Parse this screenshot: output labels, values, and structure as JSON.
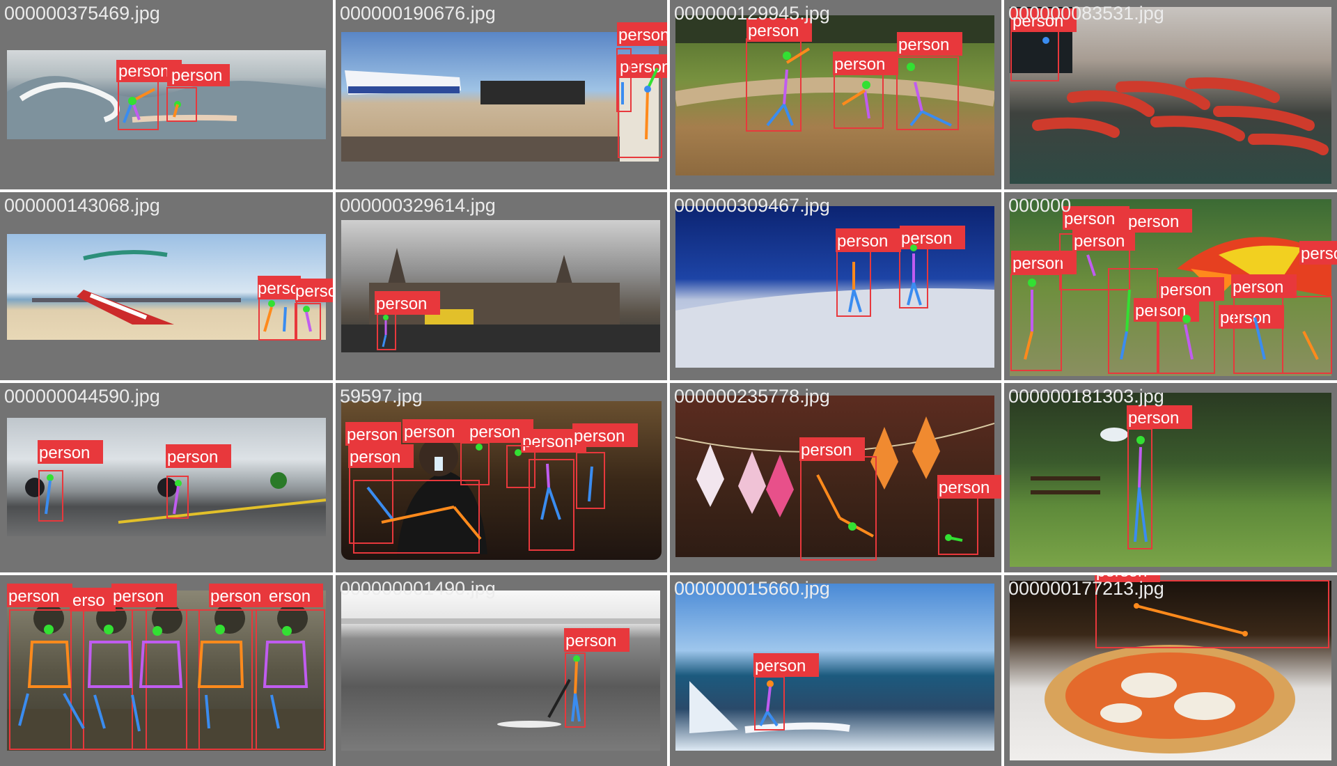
{
  "grid_title": "",
  "box_color": "#e8383c",
  "label_text_color": "#ffffff",
  "tile_background": "#737373",
  "skeleton_colors": {
    "head": "#33e033",
    "arms": "#ff8a1c",
    "torso": "#c05cf0",
    "legs": "#3a8cf0"
  },
  "tiles": [
    {
      "filename": "000000375469.jpg",
      "scene": "surf-wave",
      "detections": [
        {
          "label": "person"
        },
        {
          "label": "person"
        }
      ]
    },
    {
      "filename": "000000190676.jpg",
      "scene": "airfield-plane",
      "detections": [
        {
          "label": "person"
        },
        {
          "label": "person"
        }
      ]
    },
    {
      "filename": "000000129945.jpg",
      "scene": "baseball-field",
      "detections": [
        {
          "label": "person"
        },
        {
          "label": "person"
        },
        {
          "label": "person"
        }
      ]
    },
    {
      "filename": "000000083531.jpg",
      "scene": "sausage-grill",
      "detections": [
        {
          "label": "person"
        }
      ]
    },
    {
      "filename": "000000143068.jpg",
      "scene": "kite-beach",
      "detections": [
        {
          "label": "person"
        },
        {
          "label": "person"
        }
      ]
    },
    {
      "filename": "000000329614.jpg",
      "scene": "cathedral-street",
      "detections": [
        {
          "label": "person"
        }
      ]
    },
    {
      "filename": "000000309467.jpg",
      "scene": "ski-slope",
      "detections": [
        {
          "label": "person"
        },
        {
          "label": "person"
        }
      ]
    },
    {
      "filename": "000000",
      "scene": "picnic-umbrella",
      "detections": [
        {
          "label": "person"
        },
        {
          "label": "person"
        },
        {
          "label": "person"
        },
        {
          "label": "person"
        },
        {
          "label": "person"
        },
        {
          "label": "person"
        },
        {
          "label": "person"
        },
        {
          "label": "person"
        },
        {
          "label": "person"
        }
      ]
    },
    {
      "filename": "000000044590.jpg",
      "scene": "motorcycle-road",
      "detections": [
        {
          "label": "person"
        },
        {
          "label": "person"
        }
      ]
    },
    {
      "filename": "59597.jpg",
      "scene": "restaurant-phone",
      "detections": [
        {
          "label": "person"
        },
        {
          "label": "person"
        },
        {
          "label": "person"
        },
        {
          "label": "person"
        },
        {
          "label": "person"
        },
        {
          "label": "person"
        }
      ]
    },
    {
      "filename": "000000235778.jpg",
      "scene": "kite-festival-hall",
      "detections": [
        {
          "label": "person"
        },
        {
          "label": "person"
        }
      ]
    },
    {
      "filename": "000000181303.jpg",
      "scene": "park-trees",
      "detections": [
        {
          "label": "person"
        }
      ]
    },
    {
      "filename": "",
      "scene": "group-sitting",
      "detections": [
        {
          "label": "person"
        },
        {
          "label": "erso"
        },
        {
          "label": "person"
        },
        {
          "label": "person"
        },
        {
          "label": "erson"
        }
      ]
    },
    {
      "filename": "000000001490.jpg",
      "scene": "paddleboard-sea",
      "detections": [
        {
          "label": "person"
        }
      ]
    },
    {
      "filename": "000000015660.jpg",
      "scene": "windsurf-waves",
      "detections": [
        {
          "label": "person"
        }
      ]
    },
    {
      "filename": "000000177213.jpg",
      "scene": "pizza-plate",
      "detections": [
        {
          "label": "person"
        }
      ]
    }
  ]
}
